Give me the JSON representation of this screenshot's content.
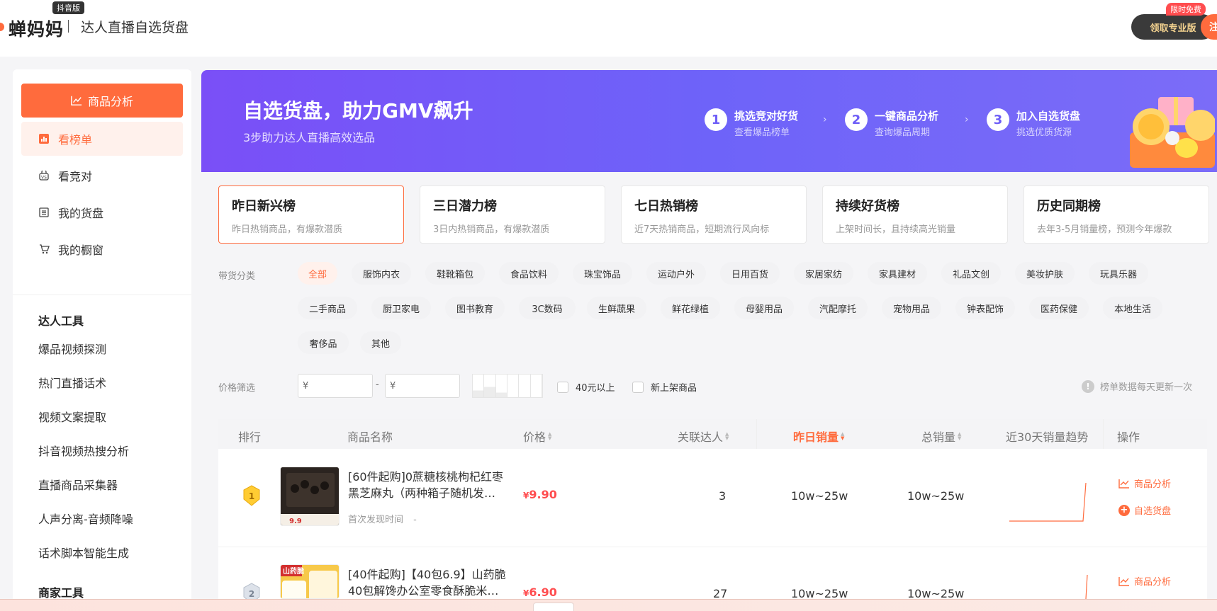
{
  "header": {
    "logo_text": "蝉妈妈",
    "logo_badge": "抖音版",
    "subtitle": "达人直播自选货盘",
    "pro_button": "领取专业版",
    "free_tag": "限时免费",
    "register_button": "注"
  },
  "sidebar": {
    "main_button": "商品分析",
    "nav": [
      {
        "label": "看榜单",
        "icon": "chart-icon",
        "active": true
      },
      {
        "label": "看竞对",
        "icon": "versus-icon",
        "active": false
      },
      {
        "label": "我的货盘",
        "icon": "list-icon",
        "active": false
      },
      {
        "label": "我的橱窗",
        "icon": "cart-icon",
        "active": false
      }
    ],
    "section_talent": "达人工具",
    "talent_tools": [
      "爆品视频探测",
      "热门直播话术",
      "视频文案提取",
      "抖音视频热搜分析",
      "直播商品采集器",
      "人声分离-音频降噪",
      "话术脚本智能生成"
    ],
    "section_merchant": "商家工具"
  },
  "banner": {
    "title": "自选货盘，助力GMV飙升",
    "subtitle": "3步助力达人直播高效选品",
    "steps": [
      {
        "num": "1",
        "title": "挑选竞对好货",
        "sub": "查看爆品榜单"
      },
      {
        "num": "2",
        "title": "一键商品分析",
        "sub": "查询爆品周期"
      },
      {
        "num": "3",
        "title": "加入自选货盘",
        "sub": "挑选优质货源"
      }
    ]
  },
  "rank_cards": [
    {
      "title": "昨日新兴榜",
      "sub": "昨日热销商品，有爆款潜质",
      "active": true
    },
    {
      "title": "三日潜力榜",
      "sub": "3日内热销商品，有爆款潜质",
      "active": false
    },
    {
      "title": "七日热销榜",
      "sub": "近7天热销商品，短期流行风向标",
      "active": false
    },
    {
      "title": "持续好货榜",
      "sub": "上架时间长，且持续高光销量",
      "active": false
    },
    {
      "title": "历史同期榜",
      "sub": "去年3-5月销量榜，预测今年爆款",
      "active": false
    }
  ],
  "filters": {
    "category_label": "带货分类",
    "categories_row1": [
      "全部",
      "服饰内衣",
      "鞋靴箱包",
      "食品饮料",
      "珠宝饰品",
      "运动户外",
      "日用百货",
      "家居家纺",
      "家具建材",
      "礼品文创",
      "美妆护肤",
      "玩具乐器"
    ],
    "categories_row2": [
      "二手商品",
      "厨卫家电",
      "图书教育",
      "3C数码",
      "生鲜蔬果",
      "鲜花绿植",
      "母婴用品",
      "汽配摩托",
      "宠物用品",
      "钟表配饰",
      "医药保健",
      "本地生活"
    ],
    "categories_row3": [
      "奢侈品",
      "其他"
    ],
    "price_label": "价格筛选",
    "price_min_placeholder": "¥",
    "price_max_placeholder": "¥",
    "price_dash": "-",
    "check_over_40": "40元以上",
    "check_new": "新上架商品",
    "update_note": "榜单数据每天更新一次"
  },
  "table": {
    "headers": {
      "rank": "排行",
      "name": "商品名称",
      "price": "价格",
      "talents": "关联达人",
      "yesterday_sales": "昨日销量",
      "total_sales": "总销量",
      "trend": "近30天销量趋势",
      "ops": "操作"
    },
    "rows": [
      {
        "rank": "1",
        "name": "[60件起购]0蔗糖核桃枸杞红枣黑芝麻丸（两种箱子随机发…",
        "found_label": "首次发现时间",
        "found_value": "-",
        "price_symbol": "¥",
        "price": "9.90",
        "talents": "3",
        "yesterday_sales": "10w~25w",
        "total_sales": "10w~25w",
        "op_analyze": "商品分析",
        "op_add": "自选货盘",
        "thumb_text": "9.9"
      },
      {
        "rank": "2",
        "name": "[40件起购]【40包6.9】山药脆40包解馋办公室零食酥脆米…",
        "found_label": "",
        "found_value": "",
        "price_symbol": "¥",
        "price": "6.90",
        "talents": "27",
        "yesterday_sales": "10w~25w",
        "total_sales": "10w~25w",
        "op_analyze": "商品分析",
        "op_add": "",
        "thumb_text": "山药脆"
      }
    ]
  },
  "colors": {
    "accent": "#ff6b3d",
    "price": "#ff4d4f",
    "banner_start": "#7a4ff7",
    "banner_end": "#7b6cf8"
  }
}
